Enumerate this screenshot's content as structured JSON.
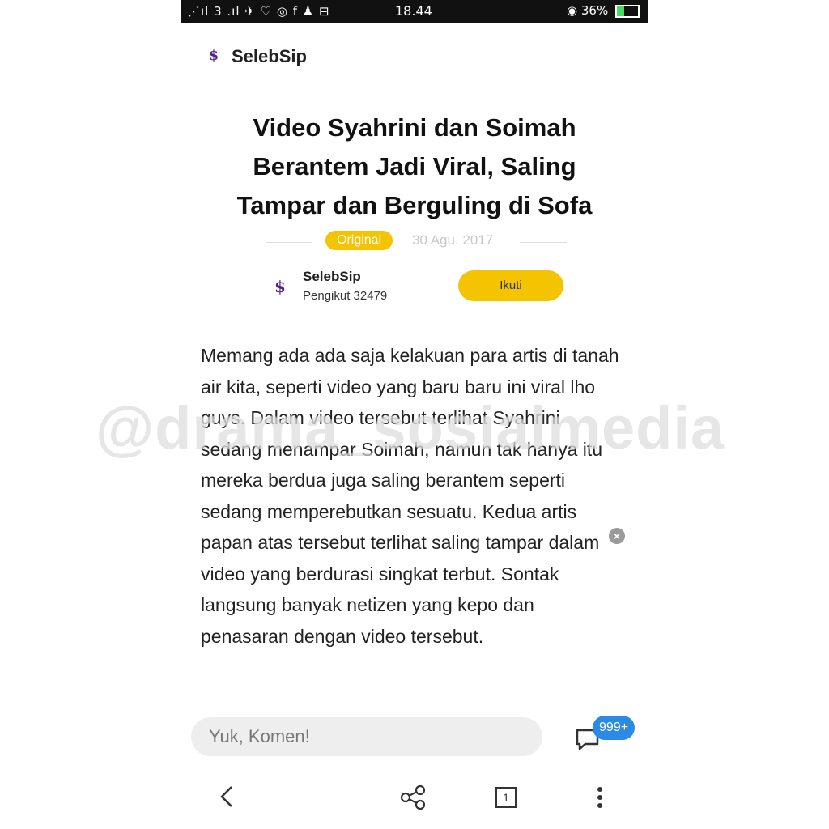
{
  "status_bar": {
    "left_icons": "⋰ıl 3 .ıl ✈ ♡ ◎ f ♟ ⊟",
    "time": "18.44",
    "right": "36%",
    "battery_level": 0.36
  },
  "header": {
    "logo_icon": "selebsip-logo",
    "site_name": "SelebSip"
  },
  "article": {
    "title": "Video Syahrini dan Soimah Berantem Jadi Viral, Saling Tampar dan Berguling di Sofa",
    "badge": "Original",
    "date": "30 Agu. 2017",
    "author": {
      "name": "SelebSip",
      "followers": "Pengikut 32479",
      "follow_label": "Ikuti"
    },
    "body": "Memang ada ada saja kelakuan para artis di tanah air kita, seperti video yang baru baru ini viral lho guys. Dalam video tersebut terlihat Syahrini sedang menampar Soimah, namun tak hanya itu mereka berdua juga saling berantem seperti sedang memperebutkan sesuatu. Kedua artis papan atas tersebut terlihat saling tampar dalam video yang berdurasi singkat terbut. Sontak langsung banyak netizen yang kepo dan penasaran dengan video tersebut."
  },
  "watermark": "@drama_sosialmedia",
  "comment": {
    "placeholder": "Yuk, Komen!",
    "count": "999+"
  },
  "nav": {
    "tabs_count": "1"
  },
  "colors": {
    "accent_yellow": "#f5c400",
    "badge_blue": "#2a8ae6",
    "logo_purple": "#5a1e8c"
  }
}
